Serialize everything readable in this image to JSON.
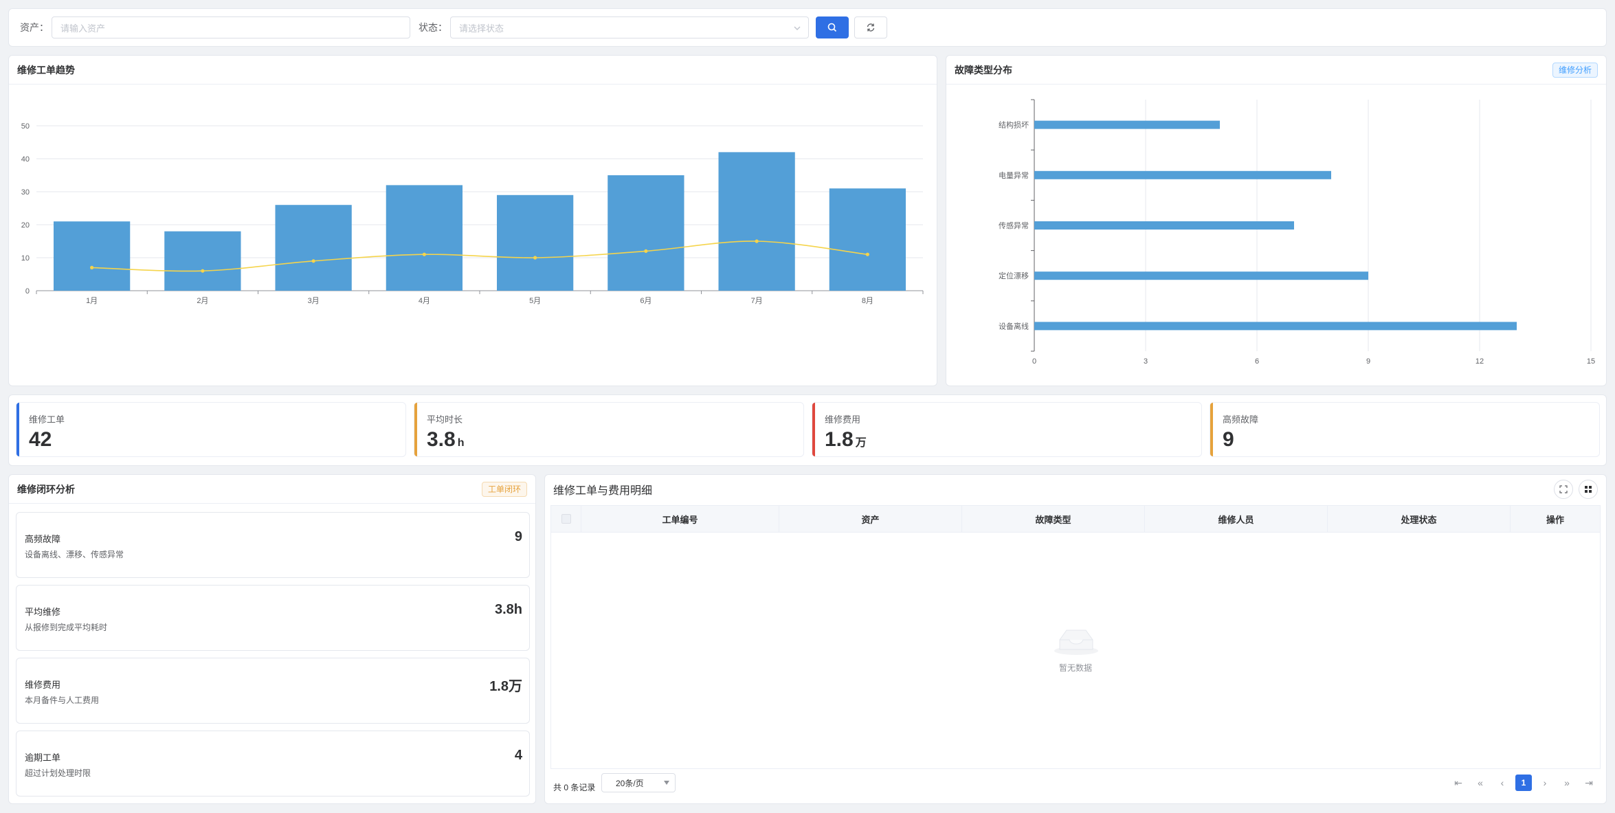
{
  "search": {
    "asset_label": "资产：",
    "asset_placeholder": "请输入资产",
    "status_label": "状态：",
    "status_placeholder": "请选择状态"
  },
  "trend": {
    "title": "维修工单趋势"
  },
  "fault": {
    "title": "故障类型分布",
    "tag": "维修分析"
  },
  "chart_data": [
    {
      "type": "bar",
      "title": "维修工单趋势",
      "categories": [
        "1月",
        "2月",
        "3月",
        "4月",
        "5月",
        "6月",
        "7月",
        "8月"
      ],
      "series": [
        {
          "type": "bar",
          "values": [
            21,
            18,
            26,
            32,
            29,
            35,
            42,
            31
          ],
          "color": "#539fd7"
        },
        {
          "type": "line",
          "smooth": true,
          "values": [
            7,
            6,
            9,
            11,
            10,
            12,
            15,
            11
          ],
          "color": "#f5d44b"
        }
      ],
      "ylim": [
        0,
        50
      ],
      "yticks": [
        0,
        10,
        20,
        30,
        40,
        50
      ],
      "grid": true
    },
    {
      "type": "bar",
      "orientation": "horizontal",
      "title": "故障类型分布",
      "categories": [
        "设备离线",
        "定位漂移",
        "传感异常",
        "电量异常",
        "结构损坏"
      ],
      "values": [
        13,
        9,
        7,
        8,
        5
      ],
      "color": "#539fd7",
      "xlim": [
        0,
        15
      ],
      "xticks": [
        0,
        3,
        6,
        9,
        12,
        15
      ],
      "grid": true
    }
  ],
  "stats": [
    {
      "label": "维修工单",
      "value": "42",
      "unit": "",
      "color": "#2f6fe4"
    },
    {
      "label": "平均时长",
      "value": "3.8",
      "unit": "h",
      "color": "#e6a23c"
    },
    {
      "label": "维修费用",
      "value": "1.8",
      "unit": "万",
      "color": "#e0483e"
    },
    {
      "label": "高频故障",
      "value": "9",
      "unit": "",
      "color": "#e6a23c"
    }
  ],
  "loop": {
    "title": "维修闭环分析",
    "tag": "工单闭环",
    "items": [
      {
        "title": "高频故障",
        "desc": "设备离线、漂移、传感异常",
        "value": "9"
      },
      {
        "title": "平均维修",
        "desc": "从报修到完成平均耗时",
        "value": "3.8h"
      },
      {
        "title": "维修费用",
        "desc": "本月备件与人工费用",
        "value": "1.8万"
      },
      {
        "title": "逾期工单",
        "desc": "超过计划处理时限",
        "value": "4"
      }
    ]
  },
  "table": {
    "title": "维修工单与费用明细",
    "columns": [
      "工单编号",
      "资产",
      "故障类型",
      "维修人员",
      "处理状态",
      "操作"
    ],
    "empty_text": "暂无数据",
    "total_text": "共 0 条记录",
    "page_size": "20条/页",
    "current_page": "1"
  }
}
